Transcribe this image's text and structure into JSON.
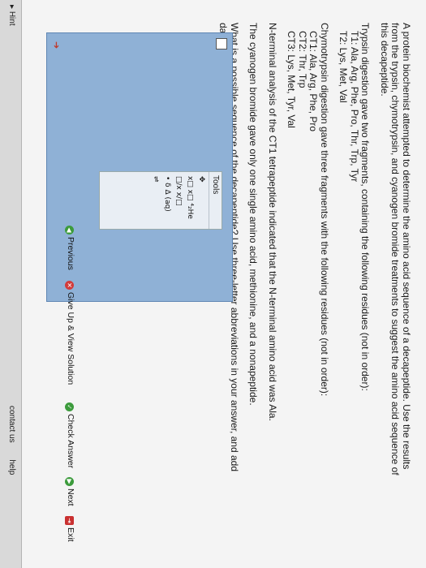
{
  "question": {
    "intro": "A protein biochemist attempted to determine the amino acid sequence of a decapeptide. Use the results from the trypsin, chymotrypsin, and cyanogen bromide treatments to suggest the amino acid sequence of this decapeptide.",
    "trypsin_header": "Trypsin digestion gave two fragments, containing the following residues (not in order):",
    "t1": "T1: Ala, Arg, Phe, Pro, Thr, Trp, Tyr",
    "t2": "T2: Lys, Met, Val",
    "chymo_header": "Chymotrypsin digestion gave three fragments with the following residues (not in order):",
    "ct1": "CT1: Ala, Arg, Phe, Pro",
    "ct2": "CT2: Thr, Trp",
    "ct3": "CT3: Lys, Met, Tyr, Val",
    "nterminal": "N-terminal analysis of the CT1 tetrapeptide indicated that the N-terminal amino acid was Ala.",
    "cyanogen": "The cyanogen bromide gave only one single amino acid, methionine, and a nonapeptide.",
    "prompt": "What is a possible sequence of the decapeptide? Use three-letter abbreviations in your answer, and add dashes between residues."
  },
  "tools": {
    "title": "Tools",
    "items": [
      "✥",
      "x□  x□  ⁴₂He",
      "□/x  x/□",
      "•  δ  Δ  (aq)",
      "⇌"
    ]
  },
  "buttons": {
    "previous": "Previous",
    "give_up": "Give Up & View Solution",
    "check": "Check Answer",
    "next": "Next",
    "exit": "Exit"
  },
  "footer": {
    "hint": "Hint",
    "links": [
      "contact us",
      "help"
    ]
  }
}
